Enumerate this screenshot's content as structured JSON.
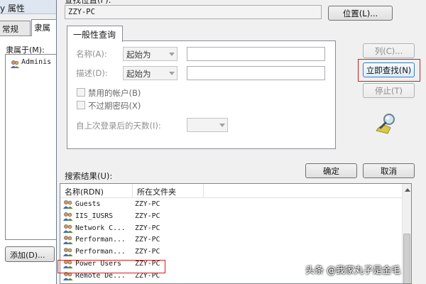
{
  "background_window": {
    "title": "y 属性",
    "tabs": [
      {
        "label": "常规"
      },
      {
        "label": "隶属"
      }
    ],
    "member_of_label": "隶属于(M):",
    "member_list": [
      {
        "name": "Adminis"
      }
    ],
    "add_button_label": "添加(D)..."
  },
  "dialog": {
    "location_label": "查找位置(F):",
    "location_value": "ZZY-PC",
    "location_button": "位置(L)...",
    "query_tab": "一般性查询",
    "query": {
      "name_label": "名称(A):",
      "name_mode": "起始为",
      "desc_label": "描述(D):",
      "desc_mode": "起始为",
      "disabled_accounts_label": "禁用的帐户(B)",
      "non_expiring_password_label": "不过期密码(X)",
      "days_since_logon_label": "自上次登录后的天数(I):"
    },
    "buttons": {
      "columns": "列(C)...",
      "find_now": "立即查找(N)",
      "stop": "停止(T)",
      "ok": "确定",
      "cancel": "取消"
    },
    "results_label": "搜索结果(U):",
    "results_columns": [
      "名称(RDN)",
      "所在文件夹"
    ],
    "results_rows": [
      {
        "name": "Guests",
        "folder": "ZZY-PC"
      },
      {
        "name": "IIS_IUSRS",
        "folder": "ZZY-PC"
      },
      {
        "name": "Network C...",
        "folder": "ZZY-PC"
      },
      {
        "name": "Performan...",
        "folder": "ZZY-PC"
      },
      {
        "name": "Performan...",
        "folder": "ZZY-PC"
      },
      {
        "name": "Power Users",
        "folder": "ZZY-PC"
      },
      {
        "name": "Remote De...",
        "folder": "ZZY-PC"
      }
    ],
    "highlighted_row": "Power Users"
  },
  "watermark": "头条 @我家丸子是金毛",
  "colors": {
    "highlight_border": "#d11f1f",
    "dialog_background": "#f0f0f0"
  }
}
